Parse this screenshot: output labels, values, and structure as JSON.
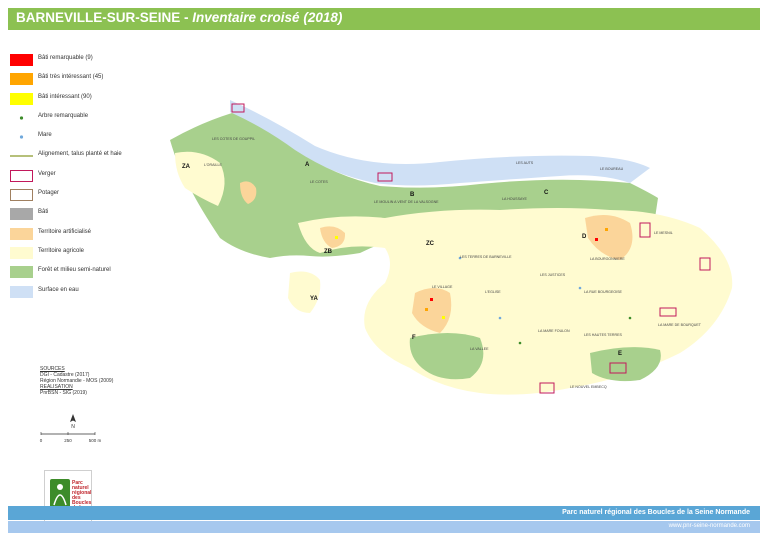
{
  "header": {
    "title": "BARNEVILLE-SUR-SEINE",
    "separator": " - ",
    "subtitle": "Inventaire croisé (2018)"
  },
  "legend": {
    "items": [
      {
        "label": "Bâti remarquable (9)",
        "color": "#ff0000",
        "kind": "fill"
      },
      {
        "label": "Bâti très intéressant (45)",
        "color": "#ffa500",
        "kind": "fill"
      },
      {
        "label": "Bâti intéressant (90)",
        "color": "#ffff00",
        "kind": "fill"
      },
      {
        "label": "Arbre remarquable",
        "color": "#3d8c2a",
        "kind": "dot"
      },
      {
        "label": "Mare",
        "color": "#6fa8dc",
        "kind": "dot"
      },
      {
        "label": "Alignement, talus planté et haie",
        "color": "#8a9a2a",
        "kind": "line"
      },
      {
        "label": "Verger",
        "color": "#c2185b",
        "kind": "outline"
      },
      {
        "label": "Potager",
        "color": "#a08060",
        "kind": "outline"
      },
      {
        "label": "Bâti",
        "color": "#a8a8a8",
        "kind": "fill"
      },
      {
        "label": "Territoire artificialisé",
        "color": "#fbd59a",
        "kind": "fill"
      },
      {
        "label": "Territoire agricole",
        "color": "#fffbd0",
        "kind": "fill"
      },
      {
        "label": "Forêt et milieu semi-naturel",
        "color": "#a8d08d",
        "kind": "fill"
      },
      {
        "label": "Surface en eau",
        "color": "#cfe0f5",
        "kind": "fill"
      }
    ]
  },
  "sources": {
    "sources_heading": "SOURCES",
    "source_1": "DGI - Cadastre (2017)",
    "source_2": "Région Normandie - MOS (2009)",
    "realisation_heading": "REALISATION",
    "realisation_1": "PnrBSN - SIG (2019)"
  },
  "scale": {
    "north": "N",
    "tick_0": "0",
    "tick_1": "250",
    "tick_2": "500 m"
  },
  "logo": {
    "text": "Parc naturel régional des Boucles de la Seine Normande"
  },
  "footer": {
    "org": "Parc naturel régional des Boucles de la Seine Normande",
    "url": "www.pnr-seine-normande.com"
  },
  "map": {
    "sectors": [
      "ZA",
      "A",
      "B",
      "C",
      "D",
      "ZB",
      "ZC",
      "YA",
      "E",
      "F"
    ],
    "places": [
      "LES COTES DE GOUPPIL",
      "L'ORAILLE",
      "LE COTES",
      "LE MOULIN A VENT DE LA VALSOGNE",
      "LES AUTS",
      "LE BOUREAU",
      "LA HOUSSAYE",
      "LES TERRES DE BARNEVILLE",
      "LE MESNIL",
      "LES JUSTICES",
      "L'EGLISE",
      "LE VILLAGE",
      "LES HAUTES TERRES",
      "LA MARE FOULON",
      "LA BOURGONNIERE",
      "LA RUE BOURGEOISE",
      "LA MARE DE BOURQUET",
      "LA VALLEE",
      "LE NOUVEL EMBECQ"
    ]
  },
  "colors": {
    "title_bar": "#8cc152",
    "footer_bar": "#5aa6d6",
    "footer_bar_light": "#a6c8ee",
    "forest": "#a8d08d",
    "agricultural": "#fffbd0",
    "artificial": "#fbd59a",
    "water": "#cfe0f5"
  }
}
